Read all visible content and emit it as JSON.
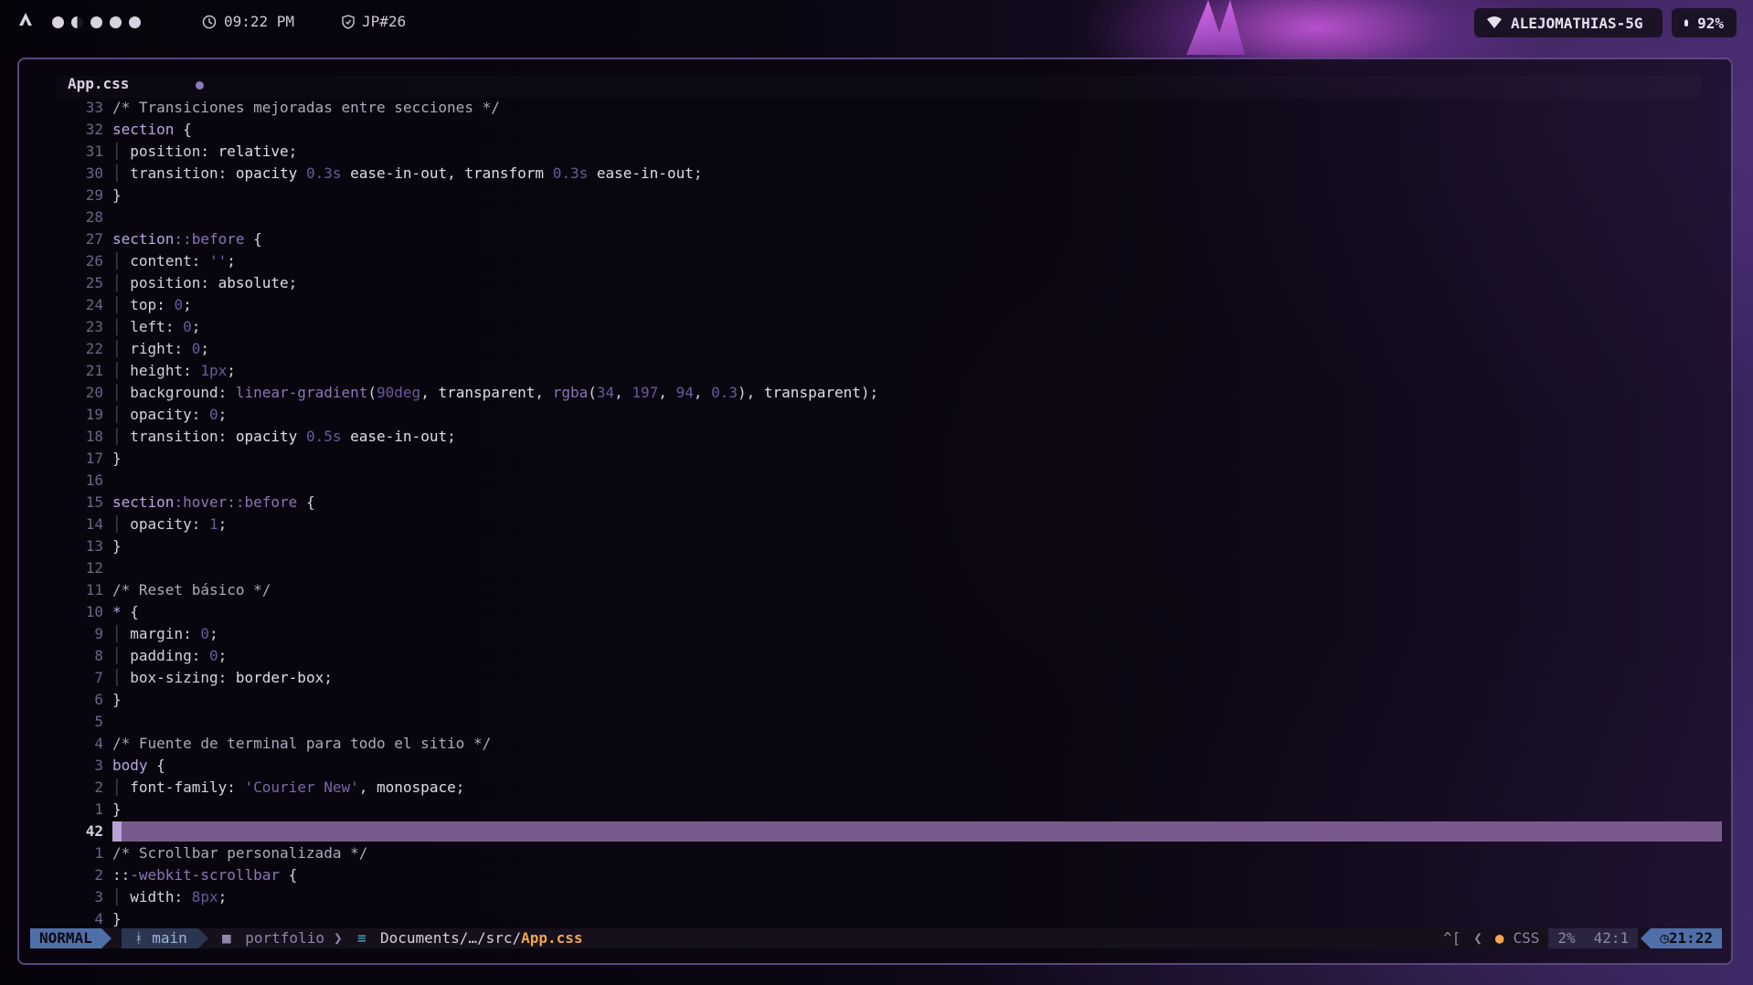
{
  "topbar": {
    "time": "09:22 PM",
    "workspace_tag": "JP#26",
    "wifi_name": "ALEJOMATHIAS-5G",
    "battery": "92%"
  },
  "editor": {
    "tab_title": "App.css",
    "lines": [
      {
        "n": "33",
        "html": "<span class='t-com'>/* Transiciones mejoradas entre secciones */</span>"
      },
      {
        "n": "32",
        "html": "<span class='t-sel'>section</span> <span class='t-punc'>{</span>"
      },
      {
        "n": "31",
        "html": "<span class='guide'>│</span> <span class='t-prop'>position</span>: <span class='t-val'>relative</span>;"
      },
      {
        "n": "30",
        "html": "<span class='guide'>│</span> <span class='t-prop'>transition</span>: <span class='t-val'>opacity</span> <span class='t-num'>0.3s</span> <span class='t-val'>ease-in-out</span>, <span class='t-val'>transform</span> <span class='t-num'>0.3s</span> <span class='t-val'>ease-in-out</span>;"
      },
      {
        "n": "29",
        "html": "<span class='t-punc'>}</span>"
      },
      {
        "n": "28",
        "html": ""
      },
      {
        "n": "27",
        "html": "<span class='t-sel'>section</span><span class='t-pseudo'>::before</span> <span class='t-punc'>{</span>"
      },
      {
        "n": "26",
        "html": "<span class='guide'>│</span> <span class='t-prop'>content</span>: <span class='t-str'>''</span>;"
      },
      {
        "n": "25",
        "html": "<span class='guide'>│</span> <span class='t-prop'>position</span>: <span class='t-val'>absolute</span>;"
      },
      {
        "n": "24",
        "html": "<span class='guide'>│</span> <span class='t-prop'>top</span>: <span class='t-num'>0</span>;"
      },
      {
        "n": "23",
        "html": "<span class='guide'>│</span> <span class='t-prop'>left</span>: <span class='t-num'>0</span>;"
      },
      {
        "n": "22",
        "html": "<span class='guide'>│</span> <span class='t-prop'>right</span>: <span class='t-num'>0</span>;"
      },
      {
        "n": "21",
        "html": "<span class='guide'>│</span> <span class='t-prop'>height</span>: <span class='t-num'>1px</span>;"
      },
      {
        "n": "20",
        "html": "<span class='guide'>│</span> <span class='t-prop'>background</span>: <span class='t-fn'>linear-gradient</span>(<span class='t-num'>90deg</span>, <span class='t-val'>transparent</span>, <span class='t-fn'>rgba</span>(<span class='t-num'>34</span>, <span class='t-num'>197</span>, <span class='t-num'>94</span>, <span class='t-num'>0.3</span>), <span class='t-val'>transparent</span>);"
      },
      {
        "n": "19",
        "html": "<span class='guide'>│</span> <span class='t-prop'>opacity</span>: <span class='t-num'>0</span>;"
      },
      {
        "n": "18",
        "html": "<span class='guide'>│</span> <span class='t-prop'>transition</span>: <span class='t-val'>opacity</span> <span class='t-num'>0.5s</span> <span class='t-val'>ease-in-out</span>;"
      },
      {
        "n": "17",
        "html": "<span class='t-punc'>}</span>"
      },
      {
        "n": "16",
        "html": ""
      },
      {
        "n": "15",
        "html": "<span class='t-sel'>section</span><span class='t-pseudo'>:hover::before</span> <span class='t-punc'>{</span>"
      },
      {
        "n": "14",
        "html": "<span class='guide'>│</span> <span class='t-prop'>opacity</span>: <span class='t-num'>1</span>;"
      },
      {
        "n": "13",
        "html": "<span class='t-punc'>}</span>"
      },
      {
        "n": "12",
        "html": ""
      },
      {
        "n": "11",
        "html": "<span class='t-com'>/* Reset básico */</span>"
      },
      {
        "n": "10",
        "html": "<span class='t-sel'>*</span> <span class='t-punc'>{</span>"
      },
      {
        "n": "9",
        "html": "<span class='guide'>│</span> <span class='t-prop'>margin</span>: <span class='t-num'>0</span>;"
      },
      {
        "n": "8",
        "html": "<span class='guide'>│</span> <span class='t-prop'>padding</span>: <span class='t-num'>0</span>;"
      },
      {
        "n": "7",
        "html": "<span class='guide'>│</span> <span class='t-prop'>box-sizing</span>: <span class='t-val'>border-box</span>;"
      },
      {
        "n": "6",
        "html": "<span class='t-punc'>}</span>"
      },
      {
        "n": "5",
        "html": ""
      },
      {
        "n": "4",
        "html": "<span class='t-com'>/* Fuente de terminal para todo el sitio */</span>"
      },
      {
        "n": "3",
        "html": "<span class='t-sel'>body</span> <span class='t-punc'>{</span>"
      },
      {
        "n": "2",
        "html": "<span class='guide'>│</span> <span class='t-prop'>font-family</span>: <span class='t-str'>'Courier New'</span>, <span class='t-val'>monospace</span>;"
      },
      {
        "n": "1",
        "html": "<span class='t-punc'>}</span>"
      },
      {
        "n": "42",
        "html": "",
        "current": true
      },
      {
        "n": "1",
        "html": "<span class='t-com'>/* Scrollbar personalizada */</span>"
      },
      {
        "n": "2",
        "html": "<span class='t-punc'>::</span><span class='t-pseudo'>-webkit-scrollbar</span> <span class='t-punc'>{</span>"
      },
      {
        "n": "3",
        "html": "<span class='guide'>│</span> <span class='t-prop'>width</span>: <span class='t-num'>8px</span>;"
      },
      {
        "n": "4",
        "html": "<span class='t-punc'>}</span>"
      }
    ]
  },
  "statusline": {
    "mode": "NORMAL",
    "branch": "main",
    "project": "portfolio",
    "path_prefix": "Documents/…/src/",
    "filename": "App.css",
    "key_hint": "^[",
    "filetype": "CSS",
    "scroll_pct": "2%",
    "position": "42:1",
    "clock": "21:22"
  },
  "colors": {
    "accent": "#4f6fa8",
    "cursorline": "#7a5a8e",
    "filename": "#f3a64a",
    "border": "#5c4680"
  }
}
